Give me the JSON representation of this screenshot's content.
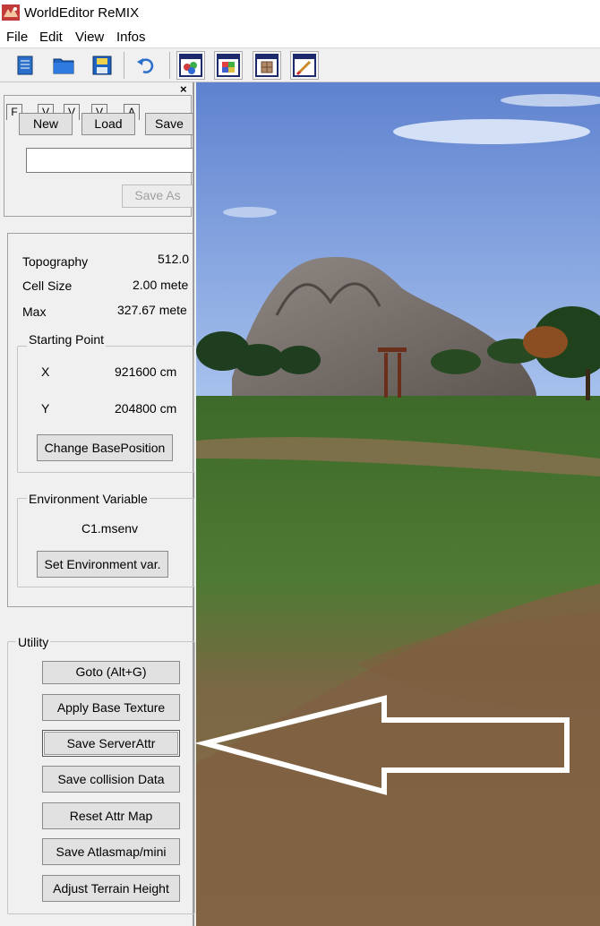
{
  "window": {
    "title": "WorldEditor ReMIX",
    "app_icon": "worldeditor-app-icon"
  },
  "menu": [
    "File",
    "Edit",
    "View",
    "Infos"
  ],
  "toolbar": {
    "icons": [
      "new-document-icon",
      "open-folder-icon",
      "save-disk-icon",
      "undo-icon",
      "terrain-view-icon",
      "texture-view-icon",
      "object-view-icon",
      "paint-brush-icon"
    ]
  },
  "panel": {
    "close_label": "×",
    "tabs": [
      "F",
      "V",
      "V",
      "V",
      "A"
    ],
    "file": {
      "new_label": "New",
      "load_label": "Load",
      "save_label": "Save",
      "path_value": "",
      "save_as_label": "Save As"
    },
    "info": {
      "topography_label": "Topography",
      "topography_value": "512.0",
      "cell_size_label": "Cell Size",
      "cell_size_value": "2.00 mete",
      "max_label": "Max",
      "max_value": "327.67 mete"
    },
    "starting_point": {
      "title": "Starting Point",
      "x_label": "X",
      "x_value": "921600 cm",
      "y_label": "Y",
      "y_value": "204800 cm",
      "change_button": "Change BasePosition"
    },
    "environment": {
      "title": "Environment Variable",
      "value": "C1.msenv",
      "set_button": "Set Environment var."
    },
    "utility": {
      "title": "Utility",
      "buttons": [
        "Goto (Alt+G)",
        "Apply Base Texture",
        "Save ServerAttr",
        "Save collision Data",
        "Reset Attr Map",
        "Save Atlasmap/mini",
        "Adjust Terrain Height"
      ]
    }
  },
  "colors": {
    "sky": "#6f8fd6",
    "grass": "#3f6f2c",
    "dirt": "#8a6a47",
    "mountain": "#7d746e",
    "arrow": "#ffffff"
  }
}
